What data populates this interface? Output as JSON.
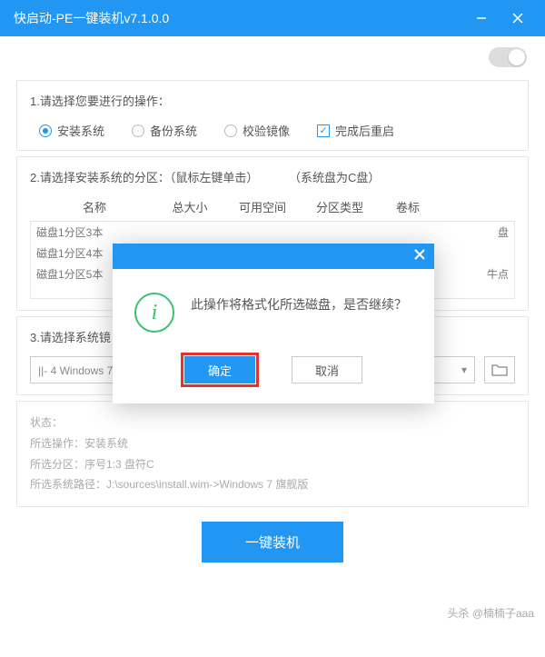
{
  "titlebar": {
    "title": "快启动-PE一键装机v7.1.0.0"
  },
  "section1": {
    "title": "1.请选择您要进行的操作：",
    "opt_install": "安装系统",
    "opt_backup": "备份系统",
    "opt_verify": "校验镜像",
    "opt_reboot": "完成后重启"
  },
  "section2": {
    "title_a": "2.请选择安装系统的分区：（鼠标左键单击）",
    "title_b": "（系统盘为C盘）",
    "head": {
      "name": "名称",
      "size": "总大小",
      "free": "可用空间",
      "type": "分区类型",
      "label": "卷标"
    },
    "rows": [
      {
        "name": "磁盘1分区3本",
        "tail": "盘"
      },
      {
        "name": "磁盘1分区4本",
        "tail": ""
      },
      {
        "name": "磁盘1分区5本",
        "tail": "牛点"
      }
    ]
  },
  "section3": {
    "title": "3.请选择系统镜",
    "select": "||- 4 Windows  7 旗舰版"
  },
  "status": {
    "l1": "状态：",
    "l2": "所选操作：安装系统",
    "l3": "所选分区：序号1:3   盘符C",
    "l4": "所选系统路径：J:\\sources\\install.wim->Windows  7 旗舰版"
  },
  "main_btn": "一键装机",
  "watermark": "头杀 @楠楠子aaa",
  "dialog": {
    "msg": "此操作将格式化所选磁盘，是否继续？",
    "ok": "确定",
    "cancel": "取消"
  }
}
